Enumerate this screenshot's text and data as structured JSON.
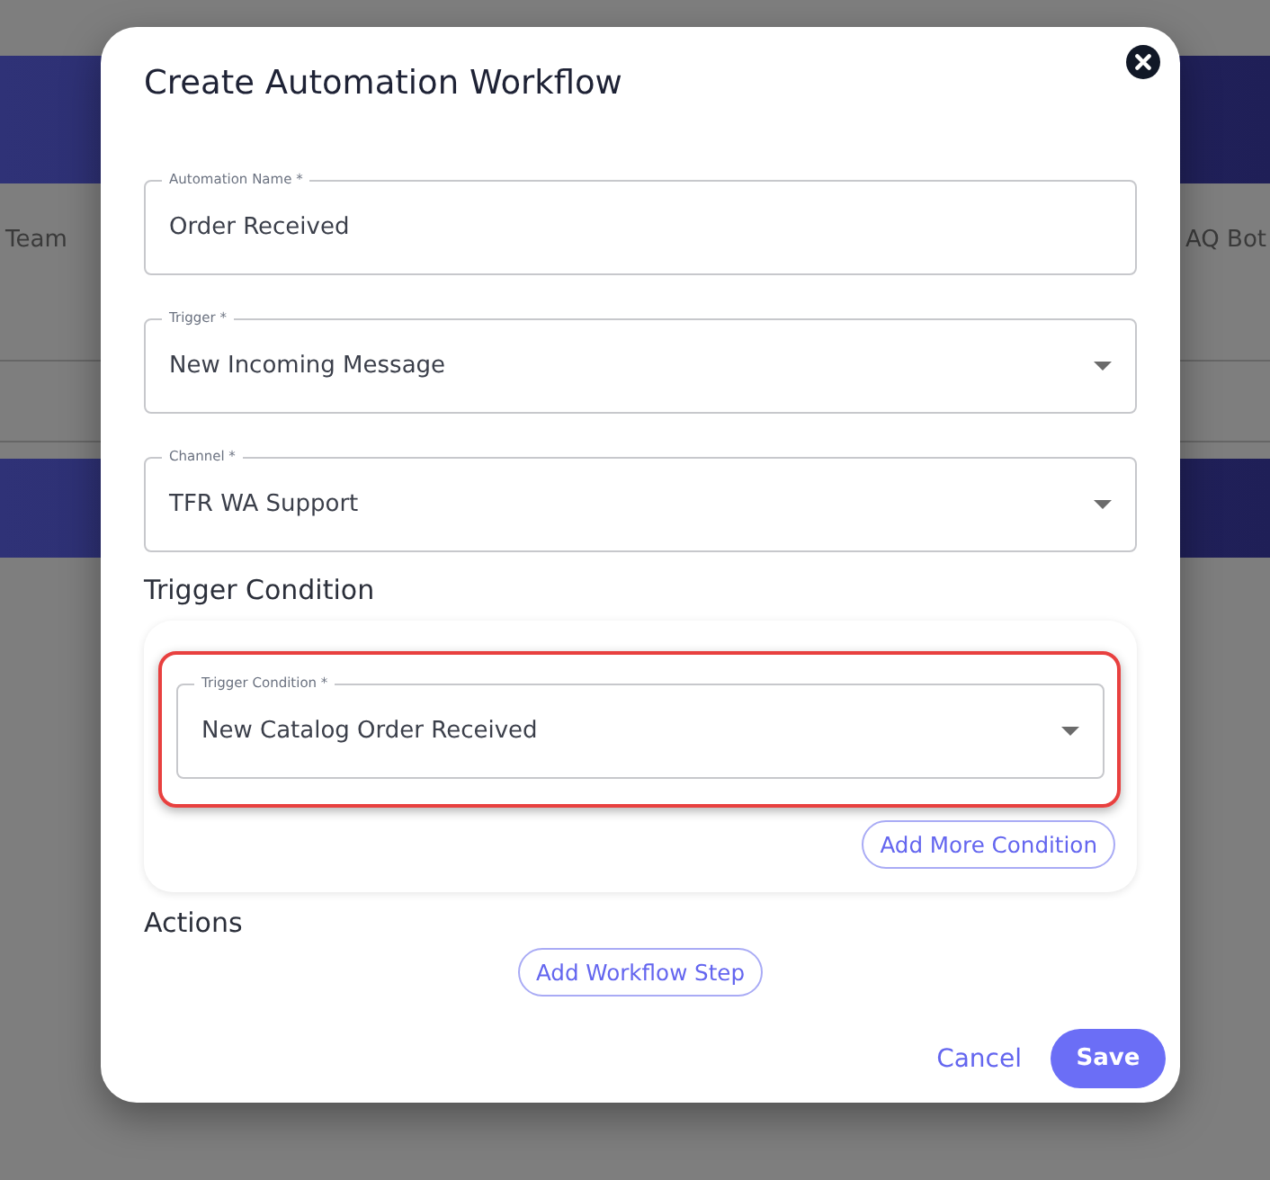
{
  "background": {
    "left_label": "Team",
    "right_label": "AQ Bot"
  },
  "dialog": {
    "title": "Create Automation Workflow",
    "fields": [
      {
        "kind": "text",
        "label": "Automation Name *",
        "value": "Order Received"
      },
      {
        "kind": "select",
        "label": "Trigger *",
        "value": "New Incoming Message"
      },
      {
        "kind": "select",
        "label": "Channel *",
        "value": "TFR WA Support"
      }
    ],
    "trigger_section": {
      "heading": "Trigger Condition",
      "conditions": [
        {
          "kind": "select",
          "label": "Trigger Condition *",
          "value": "New Catalog Order Received",
          "highlighted": true
        }
      ],
      "add_button": "Add More Condition"
    },
    "actions_section": {
      "heading": "Actions",
      "add_button": "Add Workflow Step"
    },
    "buttons": [
      {
        "kind": "text",
        "label": "Cancel"
      },
      {
        "kind": "filled",
        "label": "Save"
      }
    ]
  }
}
